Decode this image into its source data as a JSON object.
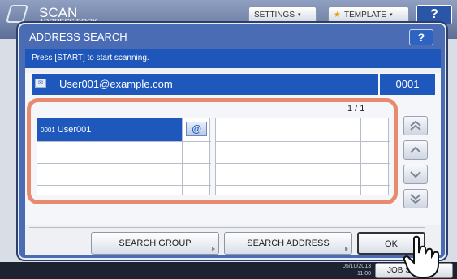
{
  "background": {
    "title": "SCAN",
    "subtitle": "ADDRESS BOOK",
    "settings_label": "SETTINGS",
    "template_label": "TEMPLATE",
    "help_label": "?",
    "date": "05/10/2013",
    "time": "11:00",
    "job_status_label": "JOB STATUS"
  },
  "dialog": {
    "title": "ADDRESS SEARCH",
    "help_label": "?",
    "message": "Press [START] to start scanning.",
    "address_value": "User001@example.com",
    "address_icon": "email-icon",
    "address_count": "0001",
    "page_indicator": "1 / 1",
    "results": [
      {
        "number": "0001",
        "name": "User001",
        "type_icon": "@"
      }
    ],
    "scroll_buttons": [
      "page-up-icon",
      "up-icon",
      "down-icon",
      "page-down-icon"
    ],
    "buttons": {
      "search_group": "SEARCH GROUP",
      "search_address": "SEARCH ADDRESS",
      "ok": "OK"
    }
  },
  "colors": {
    "accent_blue": "#1f58bd",
    "highlight": "#e88a6e"
  }
}
